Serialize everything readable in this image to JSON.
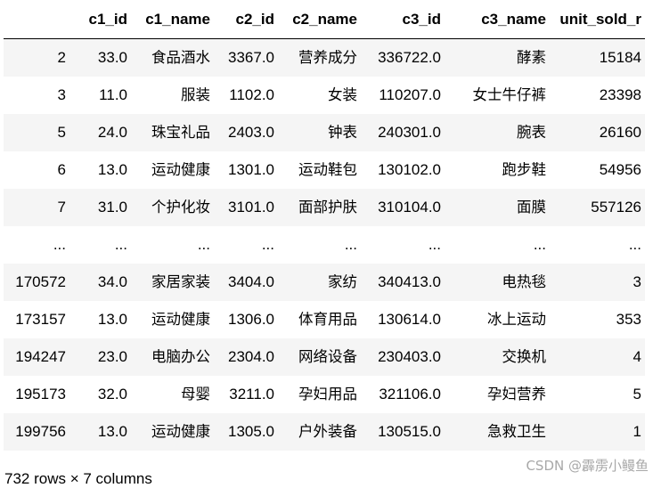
{
  "table": {
    "columns": [
      "",
      "c1_id",
      "c1_name",
      "c2_id",
      "c2_name",
      "c3_id",
      "c3_name",
      "unit_sold_r"
    ],
    "rows": [
      [
        "2",
        "33.0",
        "食品酒水",
        "3367.0",
        "营养成分",
        "336722.0",
        "酵素",
        "15184"
      ],
      [
        "3",
        "11.0",
        "服装",
        "1102.0",
        "女装",
        "110207.0",
        "女士牛仔裤",
        "23398"
      ],
      [
        "5",
        "24.0",
        "珠宝礼品",
        "2403.0",
        "钟表",
        "240301.0",
        "腕表",
        "26160"
      ],
      [
        "6",
        "13.0",
        "运动健康",
        "1301.0",
        "运动鞋包",
        "130102.0",
        "跑步鞋",
        "54956"
      ],
      [
        "7",
        "31.0",
        "个护化妆",
        "3101.0",
        "面部护肤",
        "310104.0",
        "面膜",
        "557126"
      ],
      [
        "...",
        "...",
        "...",
        "...",
        "...",
        "...",
        "...",
        "..."
      ],
      [
        "170572",
        "34.0",
        "家居家装",
        "3404.0",
        "家纺",
        "340413.0",
        "电热毯",
        "3"
      ],
      [
        "173157",
        "13.0",
        "运动健康",
        "1306.0",
        "体育用品",
        "130614.0",
        "冰上运动",
        "353"
      ],
      [
        "194247",
        "23.0",
        "电脑办公",
        "2304.0",
        "网络设备",
        "230403.0",
        "交换机",
        "4"
      ],
      [
        "195173",
        "32.0",
        "母婴",
        "3211.0",
        "孕妇用品",
        "321106.0",
        "孕妇营养",
        "5"
      ],
      [
        "199756",
        "13.0",
        "运动健康",
        "1305.0",
        "户外装备",
        "130515.0",
        "急救卫生",
        "1"
      ]
    ]
  },
  "footer": "732 rows × 7 columns",
  "watermark": "CSDN @霹雳小鳗鱼"
}
